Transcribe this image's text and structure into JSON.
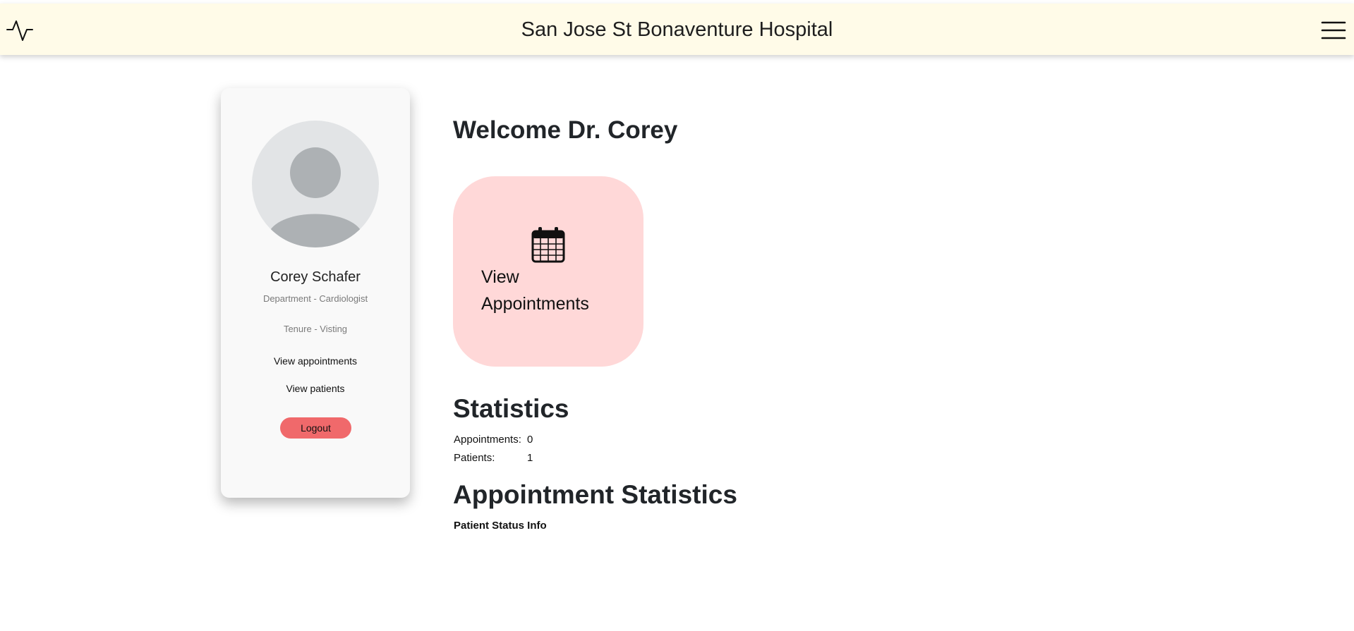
{
  "header": {
    "title": "San Jose St Bonaventure Hospital",
    "logo_icon": "pulse-icon",
    "menu_icon": "hamburger-menu-icon"
  },
  "profile": {
    "avatar_icon": "user-avatar-placeholder",
    "name": "Corey Schafer",
    "department": "Department - Cardiologist",
    "tenure": "Tenure - Visting",
    "links": {
      "appointments": "View appointments",
      "patients": "View patients"
    },
    "logout_label": "Logout",
    "logout_color": "#f0696b"
  },
  "main": {
    "welcome": "Welcome Dr. Corey",
    "tile": {
      "icon": "calendar-icon",
      "label": "View Appointments",
      "background": "#ffd8d8"
    },
    "statistics": {
      "heading": "Statistics",
      "rows": [
        {
          "label": "Appointments:",
          "value": "0"
        },
        {
          "label": "Patients:",
          "value": "1"
        }
      ]
    },
    "appointment_statistics": {
      "heading": "Appointment Statistics",
      "patient_status_label": "Patient Status Info"
    }
  },
  "colors": {
    "header_bg": "#fffbe8",
    "card_bg": "#f9f9f9"
  }
}
